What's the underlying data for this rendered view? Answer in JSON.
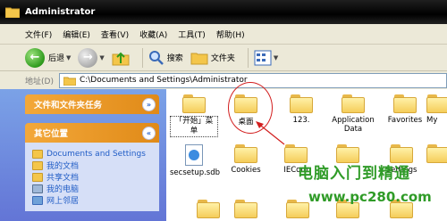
{
  "window": {
    "title": "Administrator"
  },
  "menu": [
    "文件(F)",
    "编辑(E)",
    "查看(V)",
    "收藏(A)",
    "工具(T)",
    "帮助(H)"
  ],
  "toolbar": {
    "back_label": "后退",
    "search_label": "搜索",
    "folders_label": "文件夹"
  },
  "address": {
    "label": "地址(D)",
    "path": "C:\\Documents and Settings\\Administrator"
  },
  "sidebar": {
    "tasks_title": "文件和文件夹任务",
    "places_title": "其它位置",
    "places": [
      "Documents and Settings",
      "我的文档",
      "共享文档",
      "我的电脑",
      "网上邻居"
    ]
  },
  "files": {
    "row1": [
      "「开始」菜单",
      "桌面",
      "123.",
      "Application Data",
      "Favorites",
      "My"
    ],
    "row2": [
      "secsetup.sdb",
      "Cookies",
      "IECom",
      "",
      "Settings",
      ""
    ]
  },
  "watermark": {
    "line1": "电脑入门到精通",
    "line2": "www.pc280.com"
  },
  "colors": {
    "accent_blue": "#215dc6",
    "titlebar": "#000000",
    "watermark_green": "#2f9b27",
    "annotation_red": "#d21e1e"
  }
}
